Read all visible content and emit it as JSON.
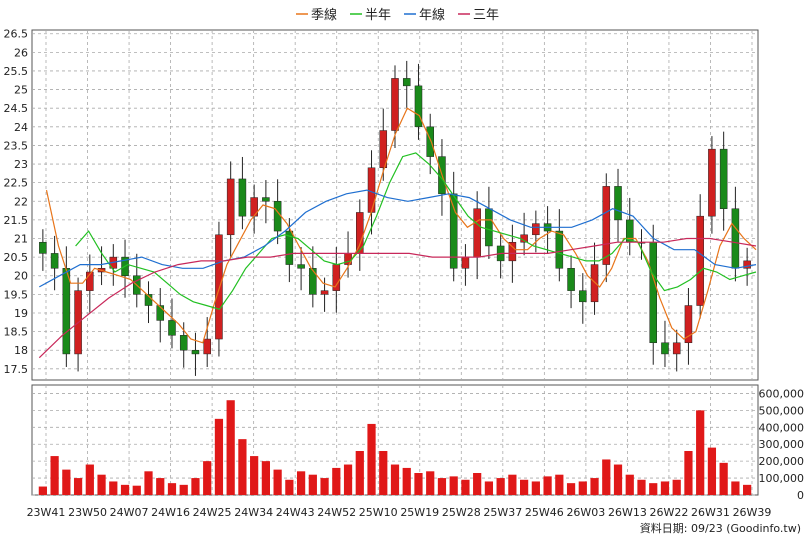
{
  "legend": [
    {
      "label": "季線",
      "color": "#e8751a"
    },
    {
      "label": "半年",
      "color": "#22c022"
    },
    {
      "label": "年線",
      "color": "#1f6fd0"
    },
    {
      "label": "三年",
      "color": "#c8285a"
    }
  ],
  "footer_note": "資料日期: 09/23 (Goodinfo.tw)",
  "colors": {
    "up": "#d02020",
    "down": "#1a8a1a",
    "volume": "#e01818",
    "grid": "#aaaaaa"
  },
  "chart_data": [
    {
      "type": "candlestick",
      "x_categories": [
        "23W41",
        "23W50",
        "24W07",
        "24W16",
        "24W25",
        "24W34",
        "24W43",
        "24W52",
        "25W10",
        "25W19",
        "25W28",
        "25W37",
        "25W46",
        "26W03",
        "26W13",
        "26W22",
        "26W31",
        "26W39"
      ],
      "y_ticks": [
        "17.5",
        "18",
        "18.5",
        "19",
        "19.5",
        "20",
        "20.5",
        "21",
        "21.5",
        "22",
        "22.5",
        "23",
        "23.5",
        "24",
        "24.5",
        "25",
        "25.5",
        "26",
        "26.5"
      ],
      "ylim": [
        17.2,
        26.6
      ],
      "grid": true,
      "legend_position": "top-center",
      "close": [
        20.6,
        20.2,
        17.9,
        19.6,
        20.1,
        20.2,
        20.5,
        20.0,
        19.5,
        19.2,
        18.8,
        18.4,
        18.0,
        17.9,
        18.3,
        21.1,
        22.6,
        21.6,
        22.1,
        22.0,
        21.2,
        20.3,
        20.2,
        19.5,
        19.6,
        20.3,
        20.6,
        21.7,
        22.9,
        23.9,
        25.3,
        25.1,
        24.0,
        23.2,
        22.2,
        20.2,
        20.5,
        21.8,
        20.8,
        20.4,
        20.9,
        21.1,
        21.4,
        21.2,
        20.2,
        19.6,
        19.3,
        20.3,
        22.4,
        21.5,
        20.9,
        20.9,
        18.2,
        17.9,
        18.2,
        19.2,
        21.6,
        23.4,
        21.8,
        20.2,
        20.4
      ],
      "volume": [
        50000,
        230000,
        150000,
        100000,
        180000,
        120000,
        80000,
        60000,
        55000,
        140000,
        100000,
        70000,
        60000,
        100000,
        200000,
        450000,
        560000,
        330000,
        230000,
        200000,
        150000,
        90000,
        140000,
        120000,
        100000,
        160000,
        180000,
        260000,
        420000,
        260000,
        180000,
        160000,
        130000,
        140000,
        100000,
        110000,
        90000,
        130000,
        80000,
        100000,
        120000,
        90000,
        80000,
        110000,
        120000,
        70000,
        80000,
        100000,
        210000,
        180000,
        120000,
        90000,
        70000,
        80000,
        90000,
        260000,
        500000,
        280000,
        190000,
        80000,
        60000
      ],
      "series": [
        {
          "name": "季線",
          "values": [
            22.3,
            20.8,
            19.8,
            19.8,
            20.2,
            20.1,
            20.0,
            19.9,
            19.6,
            19.3,
            19.0,
            18.7,
            18.3,
            18.2,
            19.3,
            20.3,
            20.9,
            21.5,
            21.9,
            21.8,
            21.4,
            20.8,
            20.2,
            19.8,
            19.7,
            20.2,
            20.8,
            21.7,
            22.8,
            23.8,
            24.5,
            24.3,
            23.6,
            22.6,
            21.7,
            21.3,
            21.5,
            21.5,
            21.0,
            20.7,
            20.7,
            21.0,
            21.2,
            21.1,
            20.6,
            20.0,
            19.7,
            20.2,
            21.0,
            21.0,
            20.4,
            19.4,
            18.6,
            18.3,
            18.5,
            19.6,
            20.8,
            21.4,
            21.0,
            20.7
          ]
        },
        {
          "name": "半年",
          "values": [
            20.8,
            21.2,
            20.6,
            20.1,
            20.3,
            20.2,
            20.1,
            19.8,
            19.5,
            19.3,
            19.2,
            19.1,
            19.6,
            20.2,
            20.6,
            21.0,
            21.1,
            21.0,
            20.7,
            20.4,
            20.3,
            20.4,
            20.8,
            21.6,
            22.5,
            23.2,
            23.3,
            23.0,
            22.6,
            22.1,
            21.6,
            21.3,
            21.2,
            21.1,
            21.0,
            20.8,
            20.7,
            20.6,
            20.5,
            20.4,
            20.4,
            20.6,
            21.0,
            20.9,
            20.1,
            19.6,
            19.7,
            19.9,
            20.2,
            20.1,
            19.9,
            20.0,
            20.1
          ]
        },
        {
          "name": "年線",
          "values": [
            19.7,
            20.0,
            20.3,
            20.3,
            20.4,
            20.5,
            20.3,
            20.2,
            20.2,
            20.4,
            20.5,
            20.8,
            21.2,
            21.7,
            22.0,
            22.2,
            22.3,
            22.1,
            22.0,
            22.1,
            22.2,
            22.1,
            21.8,
            21.5,
            21.3,
            21.3,
            21.3,
            21.5,
            21.8,
            21.6,
            21.0,
            20.7,
            20.7,
            20.3,
            20.2,
            20.3
          ]
        },
        {
          "name": "三年",
          "values": [
            17.8,
            18.4,
            18.9,
            19.4,
            19.8,
            20.1,
            20.3,
            20.4,
            20.4,
            20.5,
            20.5,
            20.6,
            20.6,
            20.6,
            20.6,
            20.6,
            20.6,
            20.5,
            20.5,
            20.5,
            20.6,
            20.6,
            20.6,
            20.7,
            20.8,
            20.9,
            20.9,
            20.9,
            21.0,
            21.0,
            20.9,
            20.8
          ]
        }
      ],
      "volume_ticks": [
        "0",
        "100,000",
        "200,000",
        "300,000",
        "400,000",
        "500,000",
        "600,000"
      ],
      "volume_max": 650000
    }
  ]
}
